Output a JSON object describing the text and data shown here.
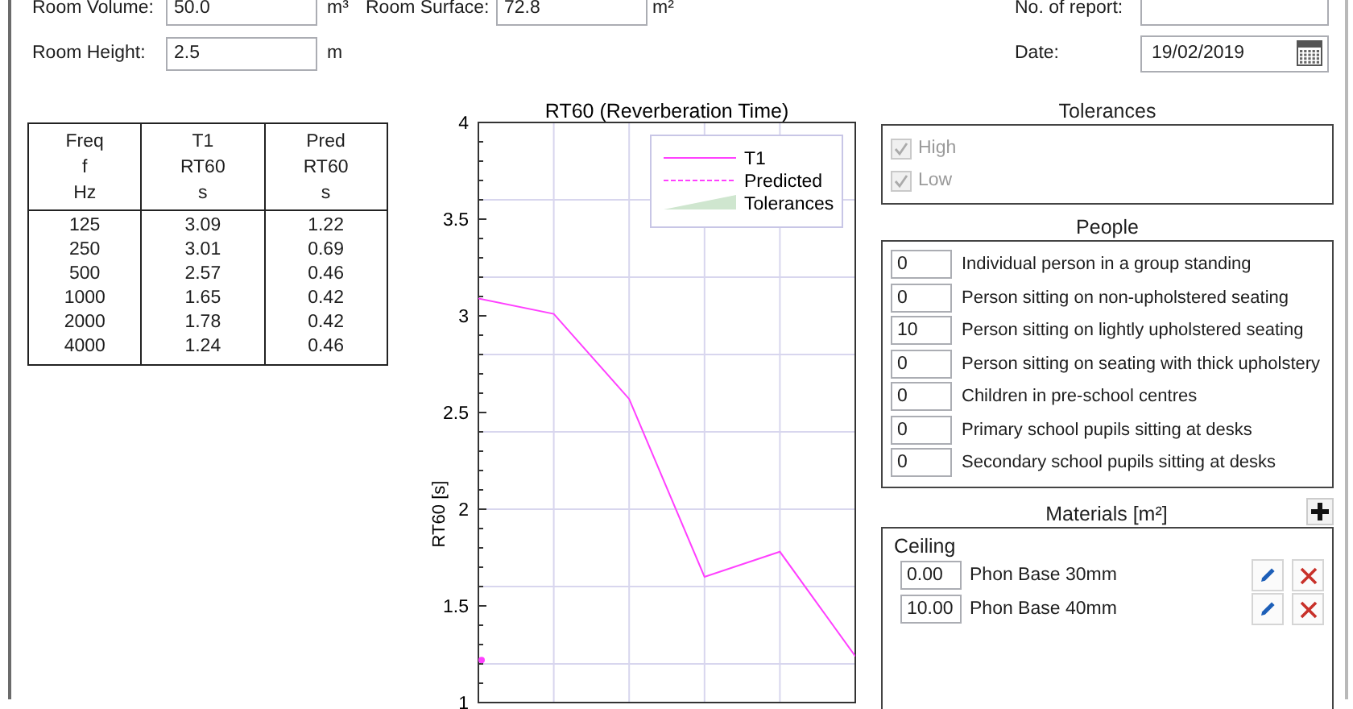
{
  "room": {
    "fields": [
      {
        "label": "Room Volume:",
        "value": "50.0",
        "unit": "m³"
      },
      {
        "label": "Room Surface:",
        "value": "72.8",
        "unit": "m²"
      },
      {
        "label": "Room Height:",
        "value": "2.5",
        "unit": "m"
      }
    ],
    "report": {
      "label": "No. of report:"
    },
    "date": {
      "label": "Date:",
      "value": "19/02/2019"
    }
  },
  "table": {
    "columns": [
      {
        "lines": [
          "Freq",
          "f",
          "Hz"
        ]
      },
      {
        "lines": [
          "T1",
          "RT60",
          "s"
        ]
      },
      {
        "lines": [
          "Pred",
          "RT60",
          "s"
        ]
      }
    ],
    "rows": [
      [
        "125",
        "3.09",
        "1.22"
      ],
      [
        "250",
        "3.01",
        "0.69"
      ],
      [
        "500",
        "2.57",
        "0.46"
      ],
      [
        "1000",
        "1.65",
        "0.42"
      ],
      [
        "2000",
        "1.78",
        "0.42"
      ],
      [
        "4000",
        "1.24",
        "0.46"
      ]
    ]
  },
  "chart": {
    "chart_data": {
      "type": "line",
      "title": "RT60 (Reverberation Time)",
      "ylabel": "RT60 [s]",
      "series": [
        {
          "name": "T1",
          "line_style": "solid",
          "color": "#ff40ff",
          "values": [
            3.09,
            3.01,
            2.57,
            1.65,
            1.78,
            1.24
          ]
        },
        {
          "name": "Predicted",
          "line_style": "dashed",
          "marker": "circle",
          "color": "#ff40ff",
          "values": [
            1.22,
            null,
            null,
            null,
            null,
            null
          ]
        },
        {
          "name": "Tolerances",
          "type": "area",
          "color": "#cfe6cf",
          "values": [
            null,
            null,
            null,
            null,
            null,
            null
          ]
        }
      ],
      "ylim": [
        1,
        4
      ],
      "yticks": [
        1,
        1.5,
        2,
        2.5,
        3,
        3.5,
        4
      ],
      "grid": true,
      "legend": true
    }
  },
  "tolerances": {
    "title": "Tolerances",
    "options": [
      {
        "label": "High",
        "checked": true,
        "disabled": true
      },
      {
        "label": "Low",
        "checked": true,
        "disabled": true
      }
    ]
  },
  "people": {
    "title": "People",
    "items": [
      {
        "count": "0",
        "label": "Individual person in a group standing"
      },
      {
        "count": "0",
        "label": "Person sitting on non-upholstered seating"
      },
      {
        "count": "10",
        "label": "Person sitting on lightly upholstered seating"
      },
      {
        "count": "0",
        "label": "Person sitting on seating with thick upholstery"
      },
      {
        "count": "0",
        "label": "Children in pre-school centres"
      },
      {
        "count": "0",
        "label": "Primary school pupils sitting at desks"
      },
      {
        "count": "0",
        "label": "Secondary school pupils sitting at desks"
      }
    ]
  },
  "materials": {
    "title": "Materials [m²]",
    "groups": [
      {
        "name": "Ceiling",
        "items": [
          {
            "area": "0.00",
            "name": "Phon Base 30mm"
          },
          {
            "area": "10.00",
            "name": "Phon Base 40mm"
          }
        ]
      }
    ]
  }
}
